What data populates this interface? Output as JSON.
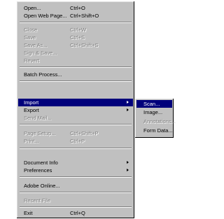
{
  "file_menu": {
    "items": [
      {
        "label": "Open...",
        "shortcut": "Ctrl+O"
      },
      {
        "label": "Open Web Page...",
        "shortcut": "Ctrl+Shift+O"
      },
      {
        "label": "Close",
        "shortcut": "Ctrl+W"
      },
      {
        "label": "Save",
        "shortcut": "Ctrl+S"
      },
      {
        "label": "Save As...",
        "shortcut": "Ctrl+Shift+S"
      },
      {
        "label": "Sign & Save...",
        "shortcut": ""
      },
      {
        "label": "Revert",
        "shortcut": ""
      },
      {
        "label": "Batch Process...",
        "shortcut": ""
      },
      {
        "label": "Import",
        "shortcut": ""
      },
      {
        "label": "Export",
        "shortcut": ""
      },
      {
        "label": "Send Mail...",
        "shortcut": ""
      },
      {
        "label": "Page Setup...",
        "shortcut": "Ctrl+Shift+P"
      },
      {
        "label": "Print...",
        "shortcut": "Ctrl+P"
      },
      {
        "label": "Document Info",
        "shortcut": ""
      },
      {
        "label": "Preferences",
        "shortcut": ""
      },
      {
        "label": "Adobe Online...",
        "shortcut": ""
      },
      {
        "label": "Recent File",
        "shortcut": ""
      },
      {
        "label": "Exit",
        "shortcut": "Ctrl+Q"
      }
    ]
  },
  "import_submenu": {
    "items": [
      {
        "label": "Scan..."
      },
      {
        "label": "Image..."
      },
      {
        "label": "Annotations..."
      },
      {
        "label": "Form Data..."
      }
    ]
  },
  "colors": {
    "menu_bg": "#c0c0c0",
    "highlight": "#00007b",
    "disabled_text": "#808080"
  },
  "icons": {
    "submenu_arrow": "chevron-right-icon"
  }
}
